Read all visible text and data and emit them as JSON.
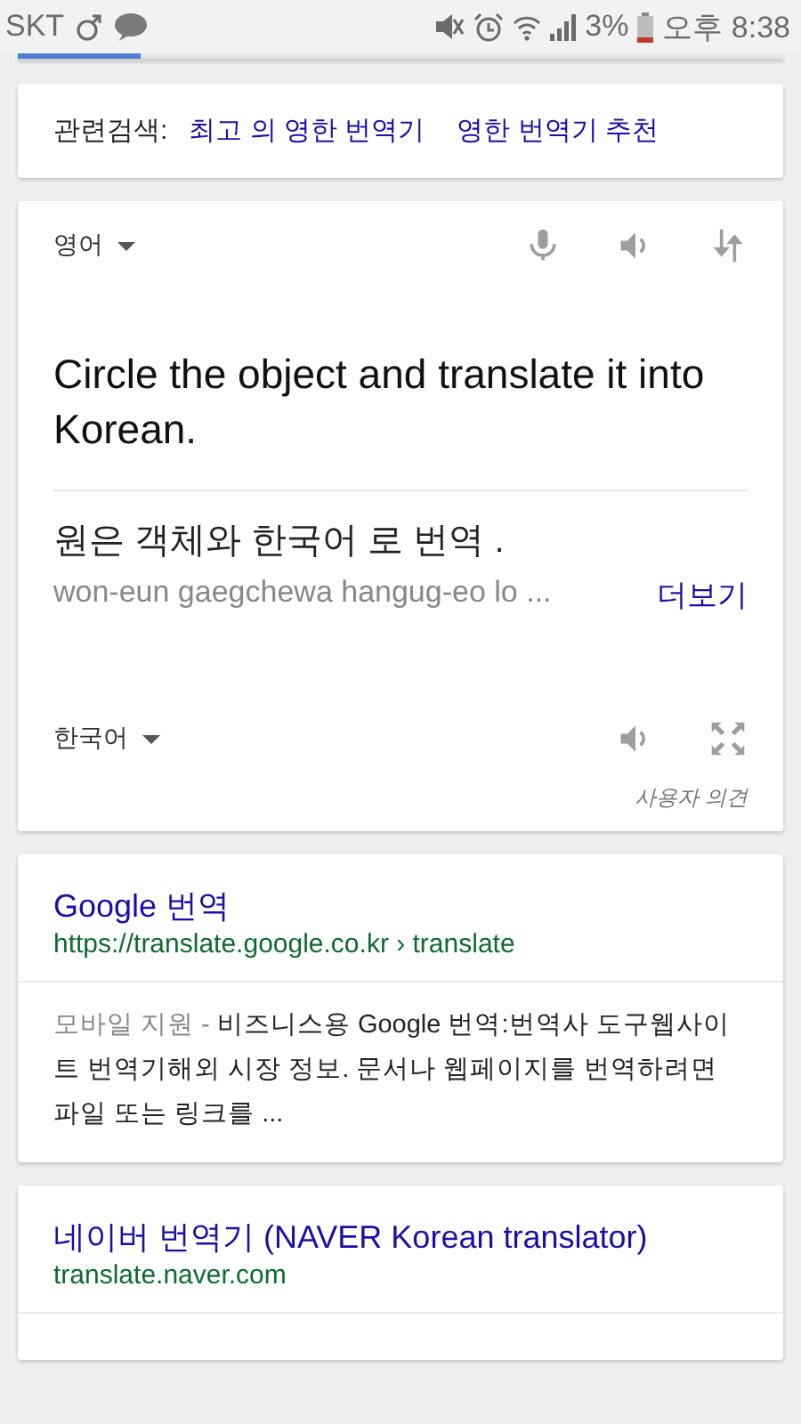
{
  "status_bar": {
    "carrier": "SKT",
    "battery": "3%",
    "time": "오후 8:38"
  },
  "page_load": {
    "level": 0.16
  },
  "related": {
    "label": "관련검색:",
    "links": [
      "최고 의 영한 번역기",
      "영한 번역기 추천"
    ]
  },
  "translator": {
    "source_language": "영어",
    "source_text": "Circle the object and translate it into Korean.",
    "result_text": "원은 객체와 한국어 로 번역 .",
    "romanization": "won-eun gaegchewa hangug-eo lo ...",
    "more_link": "더보기",
    "target_language": "한국어",
    "feedback": "사용자 의견"
  },
  "results": [
    {
      "title": "Google 번역",
      "url": "https://translate.google.co.kr › translate",
      "meta": "모바일 지원 -",
      "snippet": "비즈니스용 Google 번역:번역사 도구웹사이트 번역기해외 시장 정보. 문서나 웹페이지를 번역하려면 파일 또는 링크를 ..."
    },
    {
      "title": "네이버 번역기 (NAVER Korean translator)",
      "url": "translate.naver.com"
    }
  ]
}
